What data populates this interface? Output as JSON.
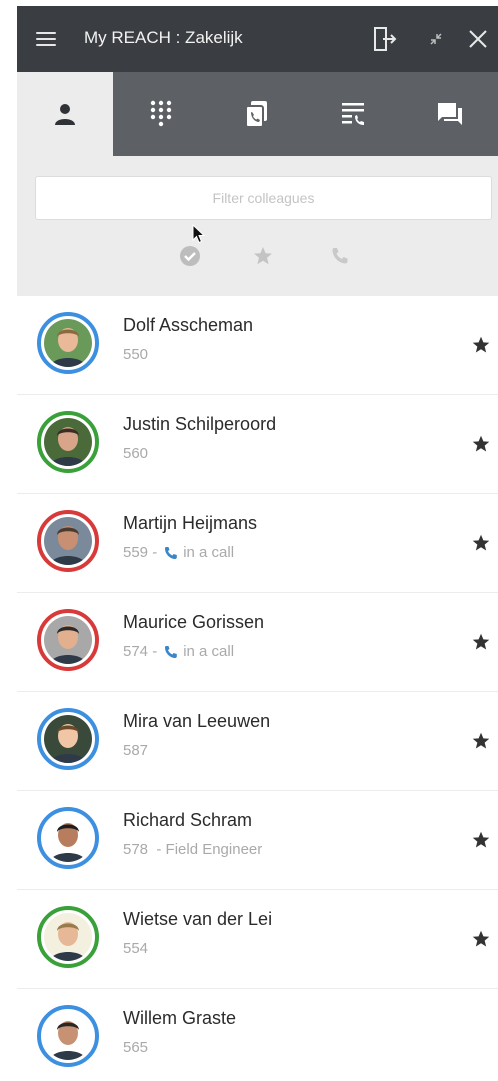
{
  "window": {
    "title": "My REACH : Zakelijk"
  },
  "icons": {
    "menu": "hamburger-menu-icon",
    "logout": "exit-door-icon",
    "minimize": "minimize-arrows-icon",
    "close": "close-icon",
    "tabs": [
      "person-icon",
      "dialpad-icon",
      "call-history-icon",
      "queue-list-icon",
      "chat-icon"
    ],
    "filters": [
      "available-check-icon",
      "favorite-star-icon",
      "phone-icon"
    ]
  },
  "filter": {
    "placeholder": "Filter colleagues"
  },
  "colors": {
    "titlebar": "#3a3e43",
    "tabbar": "#5d6166",
    "available": "#3d8fe0",
    "online": "#3aa03a",
    "busy": "#d83a3a"
  },
  "contacts": [
    {
      "name": "Dolf Asscheman",
      "ext": "550",
      "status_text": "",
      "role": "",
      "status": "blue",
      "favorite": true
    },
    {
      "name": "Justin Schilperoord",
      "ext": "560",
      "status_text": "",
      "role": "",
      "status": "green",
      "favorite": true
    },
    {
      "name": "Martijn Heijmans",
      "ext": "559",
      "status_text": "in a call",
      "role": "",
      "status": "red",
      "favorite": true
    },
    {
      "name": "Maurice Gorissen",
      "ext": "574",
      "status_text": "in a call",
      "role": "",
      "status": "red",
      "favorite": true
    },
    {
      "name": "Mira van Leeuwen",
      "ext": "587",
      "status_text": "",
      "role": "",
      "status": "blue",
      "favorite": true
    },
    {
      "name": "Richard Schram",
      "ext": "578",
      "status_text": "",
      "role": "Field Engineer",
      "status": "blue",
      "favorite": true
    },
    {
      "name": "Wietse van der Lei",
      "ext": "554",
      "status_text": "",
      "role": "",
      "status": "green",
      "favorite": true
    },
    {
      "name": "Willem Graste",
      "ext": "565",
      "status_text": "",
      "role": "",
      "status": "blue",
      "favorite": false
    }
  ]
}
